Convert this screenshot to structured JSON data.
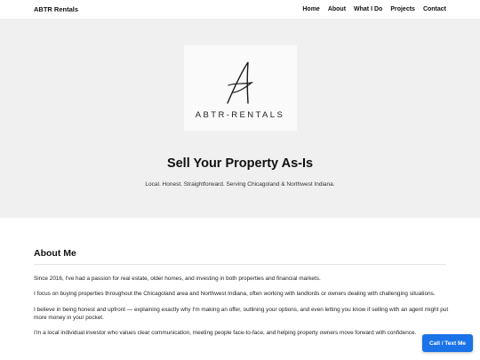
{
  "header": {
    "brand": "ABTR Rentals",
    "nav": [
      "Home",
      "About",
      "What I Do",
      "Projects",
      "Contact"
    ]
  },
  "hero": {
    "logo_text": "ABTR-RENTALS",
    "title": "Sell Your Property As-Is",
    "subtitle": "Local. Honest. Straightforward. Serving Chicagoland & Northwest Indiana."
  },
  "about": {
    "heading": "About Me",
    "paragraphs": [
      "Since 2016, I've had a passion for real estate, older homes, and investing in both properties and financial markets.",
      "I focus on buying properties throughout the Chicagoland area and Northwest Indiana, often working with landlords or owners dealing with challenging situations.",
      "I believe in being honest and upfront — explaining exactly why I'm making an offer, outlining your options, and even letting you know if selling with an agent might put more money in your pocket.",
      "I'm a local individual investor who values clear communication, meeting people face-to-face, and helping property owners move forward with confidence."
    ]
  },
  "cta": {
    "label": "Call / Text Me"
  },
  "colors": {
    "accent": "#1a73e8",
    "hero_bg": "#f0f0f0"
  }
}
